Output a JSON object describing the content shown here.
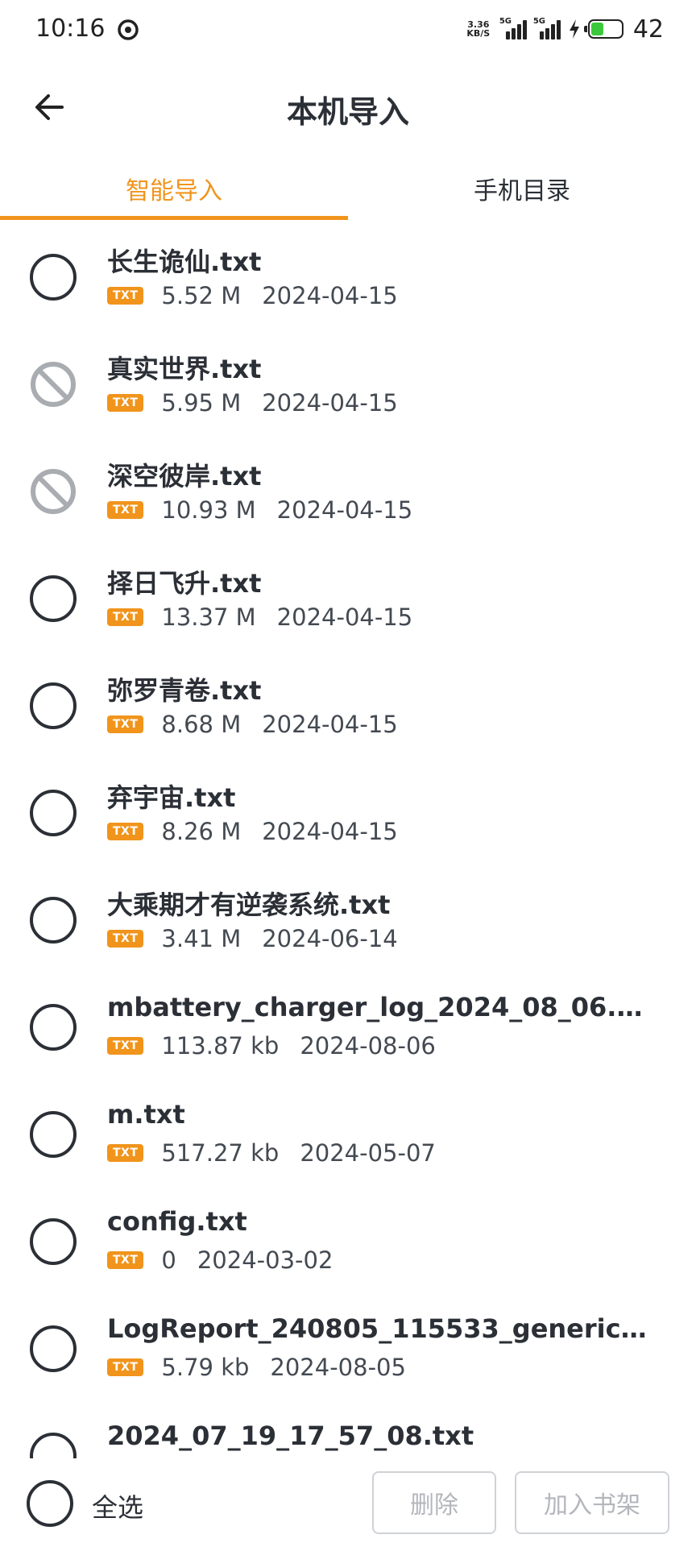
{
  "status_bar": {
    "time": "10:16",
    "net_speed_top": "3.36",
    "net_speed_bottom": "KB/S",
    "sim1_label": "5G",
    "sim2_label": "5G",
    "battery_level": "42"
  },
  "header": {
    "title": "本机导入",
    "back_icon": "arrow-left-icon"
  },
  "tabs": [
    {
      "label": "智能导入",
      "active": true
    },
    {
      "label": "手机目录",
      "active": false
    }
  ],
  "accent_color": "#f0941c",
  "files": [
    {
      "name": "长生诡仙.txt",
      "type": "TXT",
      "size": "5.52 M",
      "date": "2024-04-15",
      "disabled": false
    },
    {
      "name": "真实世界.txt",
      "type": "TXT",
      "size": "5.95 M",
      "date": "2024-04-15",
      "disabled": true
    },
    {
      "name": "深空彼岸.txt",
      "type": "TXT",
      "size": "10.93 M",
      "date": "2024-04-15",
      "disabled": true
    },
    {
      "name": "择日飞升.txt",
      "type": "TXT",
      "size": "13.37 M",
      "date": "2024-04-15",
      "disabled": false
    },
    {
      "name": "弥罗青卷.txt",
      "type": "TXT",
      "size": "8.68 M",
      "date": "2024-04-15",
      "disabled": false
    },
    {
      "name": "弃宇宙.txt",
      "type": "TXT",
      "size": "8.26 M",
      "date": "2024-04-15",
      "disabled": false
    },
    {
      "name": "大乘期才有逆袭系统.txt",
      "type": "TXT",
      "size": "3.41 M",
      "date": "2024-06-14",
      "disabled": false
    },
    {
      "name": "mbattery_charger_log_2024_08_06.t...",
      "type": "TXT",
      "size": "113.87 kb",
      "date": "2024-08-06",
      "disabled": false
    },
    {
      "name": "m.txt",
      "type": "TXT",
      "size": "517.27 kb",
      "date": "2024-05-07",
      "disabled": false
    },
    {
      "name": "config.txt",
      "type": "TXT",
      "size": "0",
      "date": "2024-03-02",
      "disabled": false
    },
    {
      "name": "LogReport_240805_115533_generic....",
      "type": "TXT",
      "size": "5.79 kb",
      "date": "2024-08-05",
      "disabled": false
    },
    {
      "name": "2024_07_19_17_57_08.txt",
      "type": "",
      "size": "",
      "date": "",
      "disabled": false
    }
  ],
  "bottom_bar": {
    "select_all_label": "全选",
    "delete_label": "删除",
    "add_to_shelf_label": "加入书架"
  }
}
